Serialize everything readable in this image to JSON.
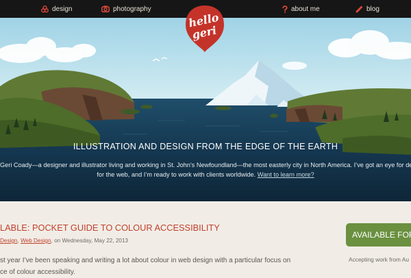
{
  "nav": {
    "design": "design",
    "photography": "photography",
    "about": "about me",
    "blog": "blog"
  },
  "logo": {
    "line1": "hello",
    "line2": "geri"
  },
  "hero": {
    "tagline": "ILLUSTRATION AND DESIGN FROM THE EDGE OF THE EARTH",
    "intro_line1": "Geri Coady—a designer and illustrator living and working in St. John’s Newfoundland—the most easterly city in North America. I’ve got an eye for detail, a",
    "intro_line2": "for the web, and I’m ready to work with clients worldwide.",
    "learn_more": "Want to learn more?"
  },
  "post": {
    "title": "LABLE: POCKET GUIDE TO COLOUR ACCESSIBILITY",
    "cat1": "Design",
    "cat2": "Web Design",
    "date": ", on Wednesday, May 22, 2013",
    "body_line1": "st year I’ve been speaking and writing a lot about colour in web design with a particular focus on",
    "body_line2": "ce of colour accessibility."
  },
  "sidebar": {
    "available_label": "AVAILABLE FOR F",
    "accepting_text": "Accepting work from Au"
  },
  "colors": {
    "topbar": "#161616",
    "accent_red": "#c1402c",
    "button_green": "#6a9040",
    "page_bg": "#f1ede6",
    "sky": "#bfe2ef",
    "water": "#16364d"
  },
  "icons": [
    "design-icon",
    "camera-icon",
    "question-icon",
    "pencil-icon"
  ]
}
